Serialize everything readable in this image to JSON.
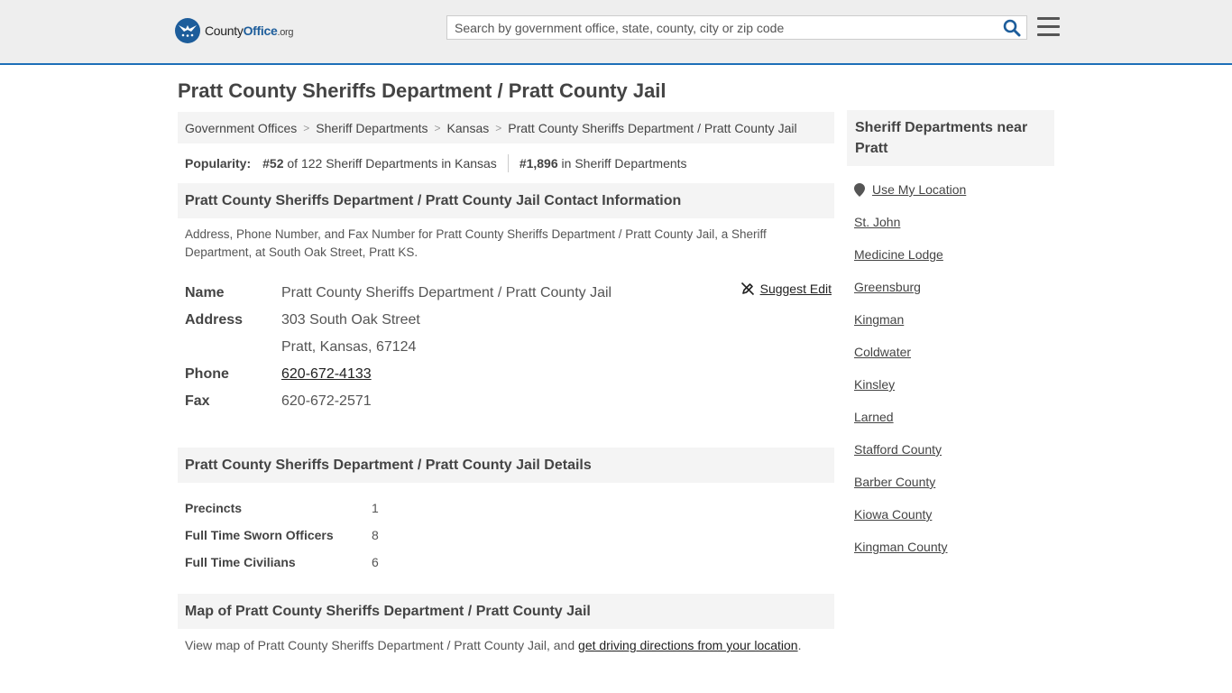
{
  "header": {
    "logo": {
      "name_main": "County",
      "name_accent": "Office",
      "tld": ".org"
    },
    "search": {
      "placeholder": "Search by government office, state, county, city or zip code"
    }
  },
  "page": {
    "title": "Pratt County Sheriffs Department / Pratt County Jail"
  },
  "breadcrumb": [
    "Government Offices",
    "Sheriff Departments",
    "Kansas",
    "Pratt County Sheriffs Department / Pratt County Jail"
  ],
  "popularity": {
    "label": "Popularity:",
    "state_rank": "#52",
    "state_text": "of 122 Sheriff Departments in Kansas",
    "national_rank": "#1,896",
    "national_text": "in Sheriff Departments"
  },
  "contact": {
    "heading": "Pratt County Sheriffs Department / Pratt County Jail Contact Information",
    "description": "Address, Phone Number, and Fax Number for Pratt County Sheriffs Department / Pratt County Jail, a Sheriff Department, at South Oak Street, Pratt KS.",
    "suggest_edit": "Suggest Edit",
    "name_label": "Name",
    "name_value": "Pratt County Sheriffs Department / Pratt County Jail",
    "address_label": "Address",
    "address_line1": "303 South Oak Street",
    "address_line2": "Pratt, Kansas, 67124",
    "phone_label": "Phone",
    "phone_value": "620-672-4133",
    "fax_label": "Fax",
    "fax_value": "620-672-2571"
  },
  "details": {
    "heading": "Pratt County Sheriffs Department / Pratt County Jail Details",
    "rows": [
      {
        "label": "Precincts",
        "value": "1"
      },
      {
        "label": "Full Time Sworn Officers",
        "value": "8"
      },
      {
        "label": "Full Time Civilians",
        "value": "6"
      }
    ]
  },
  "map": {
    "heading": "Map of Pratt County Sheriffs Department / Pratt County Jail",
    "text_before": "View map of Pratt County Sheriffs Department / Pratt County Jail, and ",
    "link": "get driving directions from your location",
    "text_after": "."
  },
  "sidebar": {
    "heading": "Sheriff Departments near Pratt",
    "use_location": "Use My Location",
    "items": [
      "St. John",
      "Medicine Lodge",
      "Greensburg",
      "Kingman",
      "Coldwater",
      "Kinsley",
      "Larned",
      "Stafford County",
      "Barber County",
      "Kiowa County",
      "Kingman County"
    ]
  },
  "colors": {
    "brand_blue": "#1d5d9b",
    "header_border": "#1d6fb8",
    "panel_bg": "#f4f4f4"
  }
}
